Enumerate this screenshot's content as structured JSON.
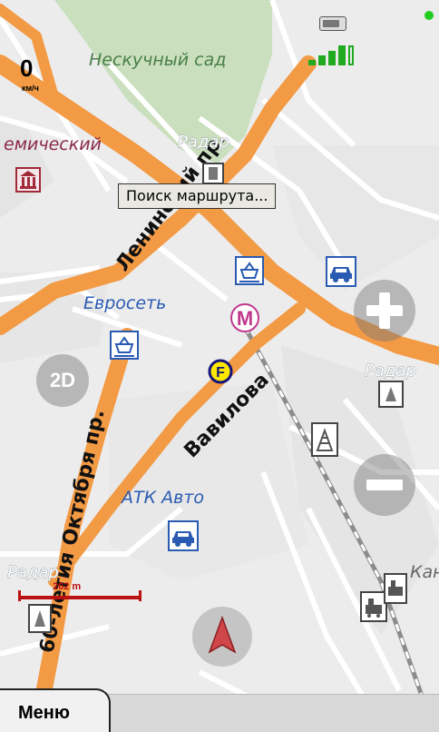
{
  "status": {
    "speed": "0",
    "speed_unit": "км/ч",
    "battery_icon": "battery-icon",
    "signal_icon": "gps-signal-icon",
    "colors": {
      "gps_ok": "#1fcc1f",
      "signal": "#1faa1f"
    }
  },
  "map": {
    "labels": {
      "park": "Нескучный сад",
      "academic": "емический",
      "radar_top": "Радар",
      "radar_right": "Радар",
      "radar_left": "Радар",
      "euroset": "Евросеть",
      "atk": "АТК Авто",
      "kan": "Кан",
      "street_leninsky": "Ленинский пр.",
      "street_vavilova": "Вавилова",
      "street_oktyabrya": "60-летия Октября пр."
    },
    "road_color": "#f39a45",
    "park_color": "#c9dfbd"
  },
  "tooltip": {
    "text": "Поиск маршрута..."
  },
  "controls": {
    "view_mode": "2D",
    "zoom_in_icon": "zoom-in-icon",
    "zoom_out_icon": "zoom-out-icon",
    "compass_icon": "compass-icon"
  },
  "scale": {
    "label": "262 m"
  },
  "footer": {
    "menu_label": "Меню"
  }
}
